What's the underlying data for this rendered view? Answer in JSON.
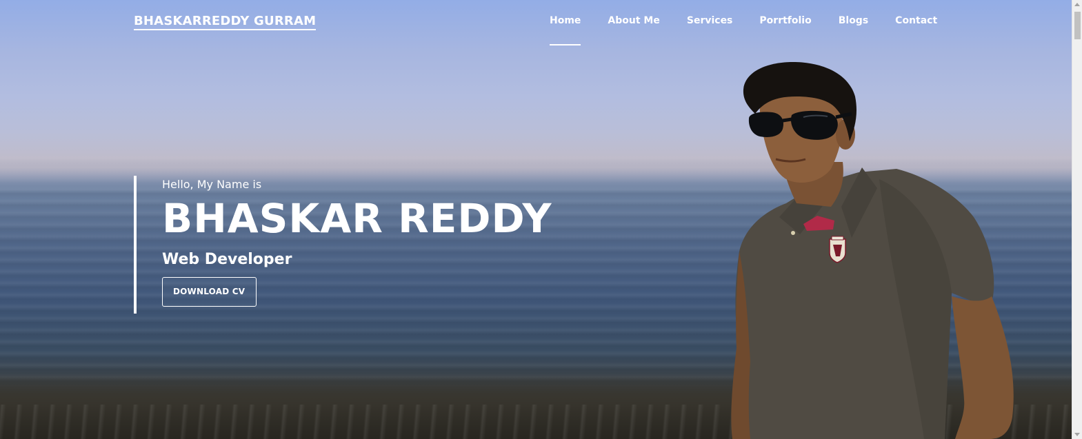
{
  "brand": {
    "name": "BHASKARREDDY GURRAM"
  },
  "nav": {
    "items": [
      {
        "label": "Home",
        "active": true
      },
      {
        "label": "About Me",
        "active": false
      },
      {
        "label": "Services",
        "active": false
      },
      {
        "label": "Porrtfolio",
        "active": false
      },
      {
        "label": "Blogs",
        "active": false
      },
      {
        "label": "Contact",
        "active": false
      }
    ]
  },
  "hero": {
    "greeting": "Hello, My Name is",
    "name": "BHASKAR REDDY",
    "role": "Web Developer",
    "cta_label": "DOWNLOAD CV"
  },
  "colors": {
    "text": "#ffffff",
    "sky_top": "#93ade6",
    "sea": "#4a6184",
    "shirt": "#514c43"
  },
  "icons": {
    "photo_subject": "person-photo",
    "shirt_badge": "shirt-crest-icon"
  }
}
